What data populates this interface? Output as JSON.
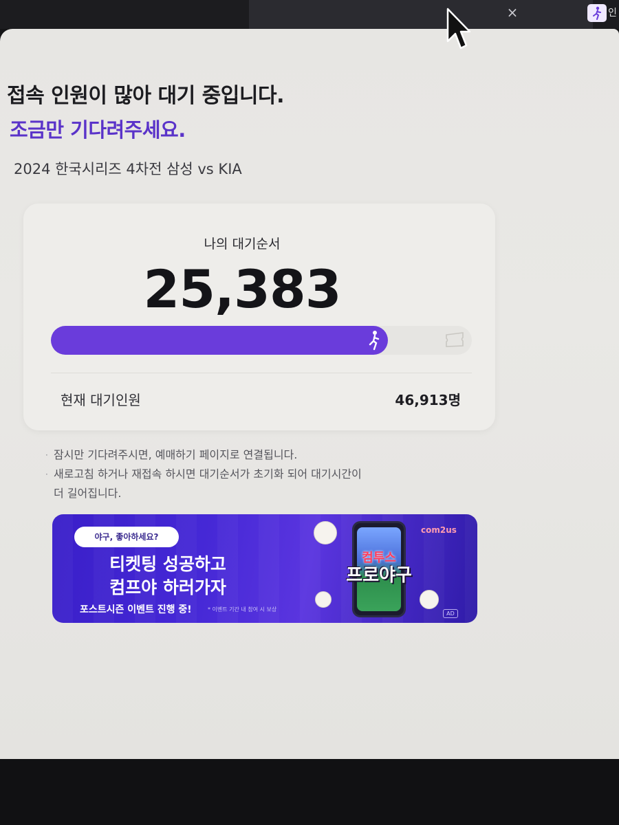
{
  "browser": {
    "tab_close_glyph": "×",
    "favicon_glyph": "🏃",
    "tab_title_fragment": "인"
  },
  "page": {
    "headline": "접속 인원이 많아 대기 중입니다.",
    "subheadline": "조금만 기다려주세요.",
    "event_title": "2024 한국시리즈 4차전 삼성 vs KIA"
  },
  "queue": {
    "label": "나의 대기순서",
    "position": "25,383",
    "progress_fraction": 0.8,
    "current_waiting_label": "현재 대기인원",
    "current_waiting_value": "46,913명"
  },
  "notes": [
    "잠시만 기다려주시면, 예매하기 페이지로 연결됩니다.",
    "새로고침 하거나 재접속 하시면 대기순서가 초기화 되어 대기시간이",
    "더 길어집니다."
  ],
  "banner": {
    "pill_text": "야구, 좋아하세요?",
    "title_line1": "티켓팅 성공하고",
    "title_line2": "컴프야 하러가자",
    "subtitle": "포스트시즌 이벤트 진행 중!",
    "fine_print": "* 이벤트 기간 내 참여 시 보상",
    "brand": "com2us",
    "game_logo_top": "컴투스",
    "game_logo_bottom": "프로야구",
    "ad_badge": "AD"
  },
  "colors": {
    "accent": "#6a3cdb",
    "subheadline": "#5a33c9",
    "banner_bg": "#4528d6"
  }
}
